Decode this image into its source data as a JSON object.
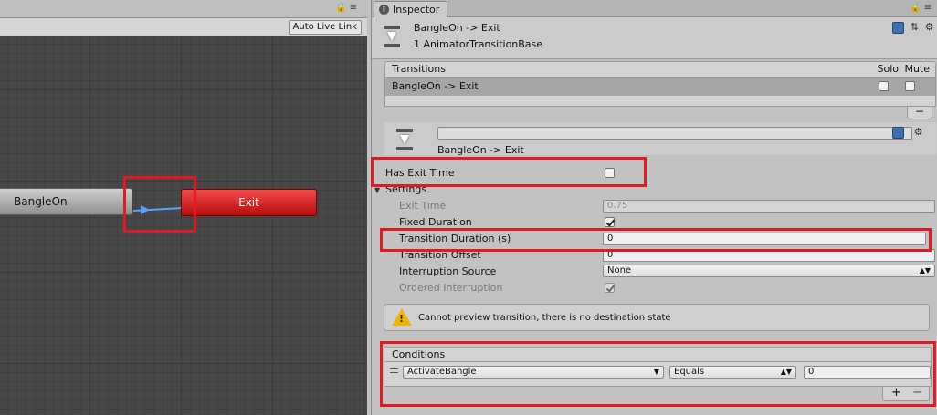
{
  "graph": {
    "auto_live_link": "Auto Live Link",
    "states": {
      "source": "BangleOn",
      "destination": "Exit"
    },
    "colors": {
      "exit_state": "#e11b22",
      "transition_line": "#5aa0ff"
    }
  },
  "inspector": {
    "tab_label": "Inspector",
    "header": {
      "title": "BangleOn -> Exit",
      "subtitle": "1 AnimatorTransitionBase"
    },
    "transitions": {
      "header": "Transitions",
      "solo_label": "Solo",
      "mute_label": "Mute",
      "rows": [
        {
          "name": "BangleOn -> Exit",
          "solo": false,
          "mute": false
        }
      ],
      "remove_label": "−"
    },
    "transition": {
      "name_value": "",
      "title": "BangleOn -> Exit",
      "has_exit_time_label": "Has Exit Time",
      "has_exit_time": false,
      "settings_label": "Settings",
      "exit_time_label": "Exit Time",
      "exit_time_value": "0.75",
      "fixed_duration_label": "Fixed Duration",
      "fixed_duration": true,
      "transition_duration_label": "Transition Duration (s)",
      "transition_duration_value": "0",
      "transition_offset_label": "Transition Offset",
      "transition_offset_value": "0",
      "interruption_source_label": "Interruption Source",
      "interruption_source_value": "None",
      "ordered_interruption_label": "Ordered Interruption",
      "ordered_interruption": true
    },
    "warning": {
      "text": "Cannot preview transition, there is no destination state"
    },
    "conditions": {
      "header": "Conditions",
      "items": [
        {
          "parameter": "ActivateBangle",
          "mode": "Equals",
          "threshold": "0"
        }
      ],
      "add_label": "+",
      "remove_label": "−"
    }
  },
  "annotations": {
    "highlight_color": "#e11b22"
  }
}
